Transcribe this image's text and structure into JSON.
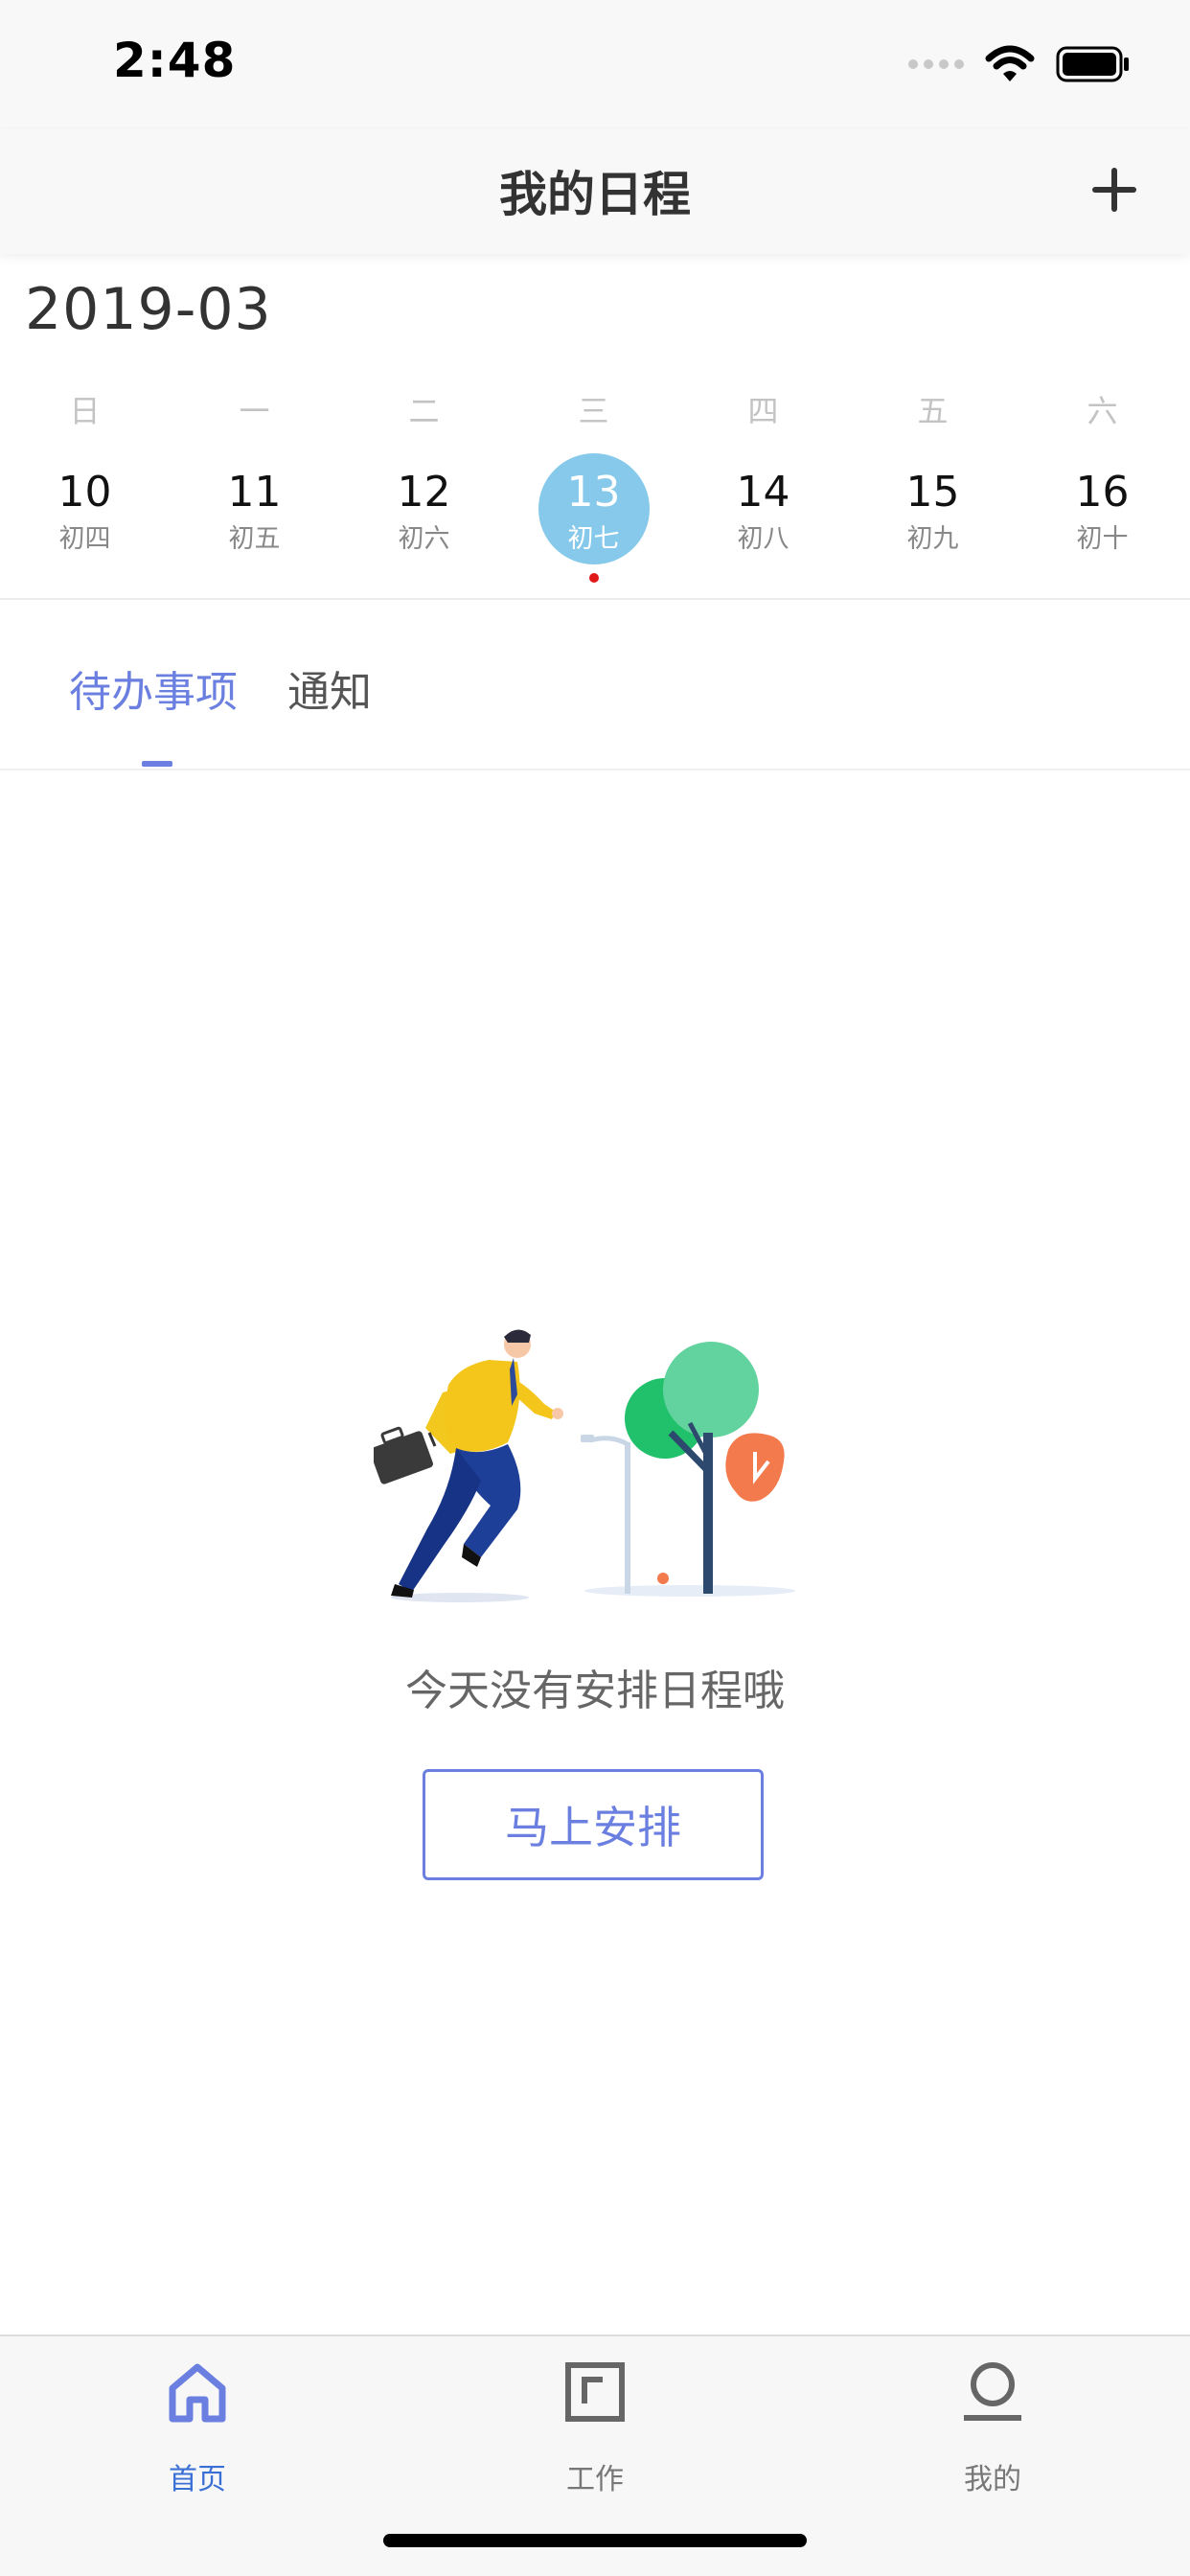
{
  "status_bar": {
    "time": "2:48",
    "icons": [
      "signal-icon",
      "wifi-icon",
      "battery-icon"
    ]
  },
  "header": {
    "title": "我的日程",
    "add_icon": "plus-icon"
  },
  "calendar": {
    "month": "2019-03",
    "weekdays": [
      "日",
      "一",
      "二",
      "三",
      "四",
      "五",
      "六"
    ],
    "days": [
      {
        "date": "10",
        "lunar": "初四",
        "selected": false
      },
      {
        "date": "11",
        "lunar": "初五",
        "selected": false
      },
      {
        "date": "12",
        "lunar": "初六",
        "selected": false
      },
      {
        "date": "13",
        "lunar": "初七",
        "selected": true,
        "has_event": true
      },
      {
        "date": "14",
        "lunar": "初八",
        "selected": false
      },
      {
        "date": "15",
        "lunar": "初九",
        "selected": false
      },
      {
        "date": "16",
        "lunar": "初十",
        "selected": false
      }
    ],
    "selected_color": "#86c9ea",
    "event_dot_color": "#e01818"
  },
  "tabs": [
    {
      "label": "待办事项",
      "active": true
    },
    {
      "label": "通知",
      "active": false
    }
  ],
  "empty_state": {
    "message": "今天没有安排日程哦",
    "button_label": "马上安排"
  },
  "tab_bar": [
    {
      "label": "首页",
      "icon": "home-icon",
      "active": true
    },
    {
      "label": "工作",
      "icon": "document-icon",
      "active": false
    },
    {
      "label": "我的",
      "icon": "profile-icon",
      "active": false
    }
  ],
  "colors": {
    "accent": "#6b7fe0",
    "tab_active": "#3a6fd6"
  }
}
